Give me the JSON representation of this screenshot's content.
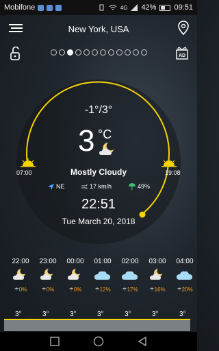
{
  "status_bar": {
    "carrier": "Mobifone",
    "network": "4G",
    "battery": "42%",
    "time": "09:51"
  },
  "header": {
    "city": "New York, USA"
  },
  "pager": {
    "count": 12,
    "active_index": 2
  },
  "current": {
    "min_max": "-1°/3°",
    "temperature": "3",
    "unit": "°C",
    "condition": "Mostly Cloudy",
    "sunrise": "07:00",
    "sunset": "19:08",
    "wind_dir": "NE",
    "wind_speed": "17 km/h",
    "humidity": "49%",
    "clock": "22:51",
    "date": "Tue March 20, 2018"
  },
  "hourly": [
    {
      "time": "22:00",
      "precip": "0%",
      "icon": "moon-cloud-icon",
      "low": "3°"
    },
    {
      "time": "23:00",
      "precip": "0%",
      "icon": "moon-cloud-icon",
      "low": "3°"
    },
    {
      "time": "00:00",
      "precip": "0%",
      "icon": "moon-cloud-icon",
      "low": "3°"
    },
    {
      "time": "01:00",
      "precip": "12%",
      "icon": "cloud-icon",
      "low": "3°"
    },
    {
      "time": "02:00",
      "precip": "17%",
      "icon": "cloud-icon",
      "low": "3°"
    },
    {
      "time": "03:00",
      "precip": "16%",
      "icon": "moon-cloud-icon",
      "low": "3°"
    },
    {
      "time": "04:00",
      "precip": "20%",
      "icon": "cloud-icon",
      "low": "3°"
    }
  ],
  "colors": {
    "accent": "#f5d300",
    "precip": "#f0a020",
    "wind": "#4aa8ff",
    "humidity": "#3cc070"
  }
}
